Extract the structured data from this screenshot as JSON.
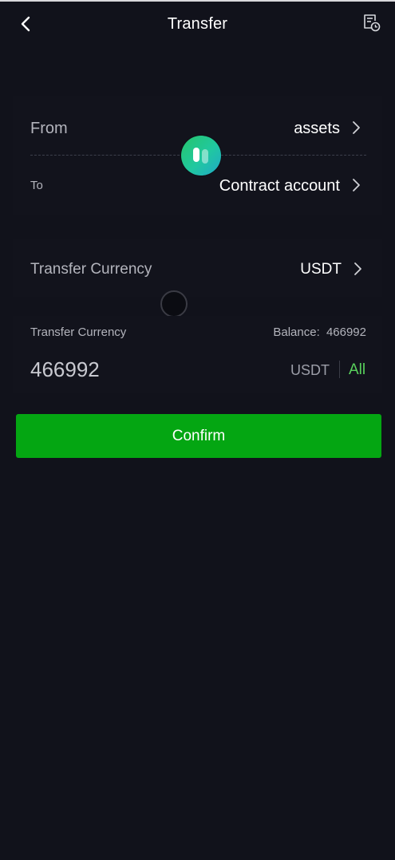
{
  "header": {
    "title": "Transfer",
    "back_icon": "chevron-left-icon",
    "record_icon": "record-clock-icon"
  },
  "accounts": {
    "from_label": "From",
    "from_value": "assets",
    "to_label": "To",
    "to_value": "Contract account",
    "swap_icon": "swap-accounts-icon"
  },
  "currency": {
    "label": "Transfer Currency",
    "value": "USDT"
  },
  "amount": {
    "label": "Transfer Currency",
    "balance_label": "Balance",
    "balance_sep": ":",
    "balance_value": "466992",
    "value": "466992",
    "unit": "USDT",
    "all_label": "All"
  },
  "actions": {
    "confirm_label": "Confirm"
  },
  "colors": {
    "background": "#11121b",
    "accent_green": "#04a612",
    "all_green": "#59d25c"
  }
}
